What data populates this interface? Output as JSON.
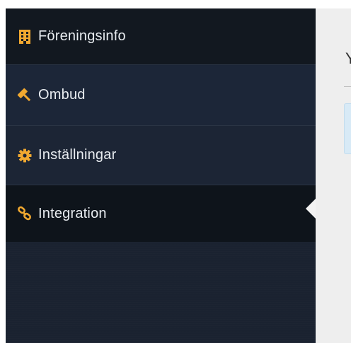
{
  "sidebar": {
    "items": [
      {
        "label": "Föreningsinfo",
        "icon": "building-icon",
        "active": false
      },
      {
        "label": "Ombud",
        "icon": "gavel-icon",
        "active": false
      },
      {
        "label": "Inställningar",
        "icon": "gear-icon",
        "active": false
      },
      {
        "label": "Integration",
        "icon": "link-icon",
        "active": true
      }
    ]
  },
  "main": {
    "heading_fragment": "Y"
  },
  "colors": {
    "sidebar_bg": "#1a2230",
    "active_bg": "#0e141b",
    "icon_accent": "#f0a830",
    "text": "#e8ecf0",
    "content_bg": "#eeeeee",
    "info_panel_bg": "#d8eaf6"
  }
}
